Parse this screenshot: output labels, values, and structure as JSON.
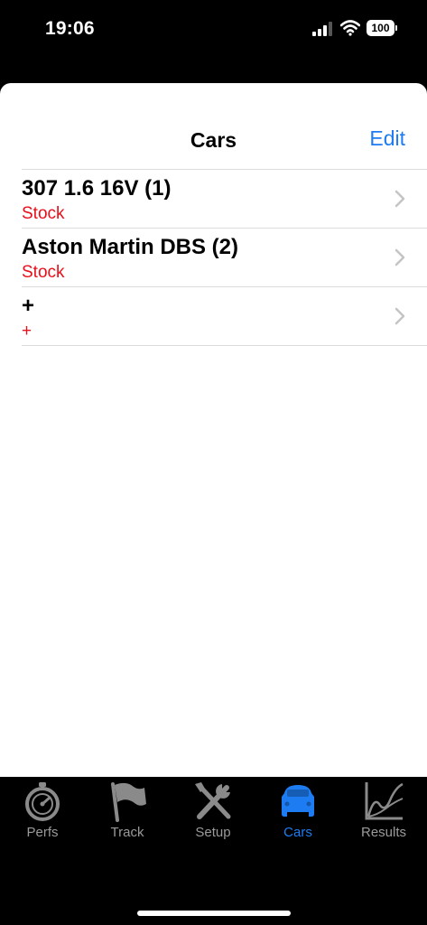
{
  "status_bar": {
    "time": "19:06",
    "battery_level": "100"
  },
  "nav": {
    "title": "Cars",
    "edit_label": "Edit"
  },
  "cars": [
    {
      "name": "307 1.6 16V (1)",
      "subtitle": "Stock"
    },
    {
      "name": "Aston Martin DBS (2)",
      "subtitle": "Stock"
    },
    {
      "name": "+",
      "subtitle": "+"
    }
  ],
  "tabs": [
    {
      "label": "Perfs",
      "icon": "stopwatch-icon"
    },
    {
      "label": "Track",
      "icon": "flag-icon"
    },
    {
      "label": "Setup",
      "icon": "tools-icon"
    },
    {
      "label": "Cars",
      "icon": "car-icon",
      "active": true
    },
    {
      "label": "Results",
      "icon": "chart-icon"
    }
  ],
  "colors": {
    "accent": "#1e7cf2",
    "subtitle_red": "#e8101a",
    "tab_inactive": "#9a9a9a"
  }
}
